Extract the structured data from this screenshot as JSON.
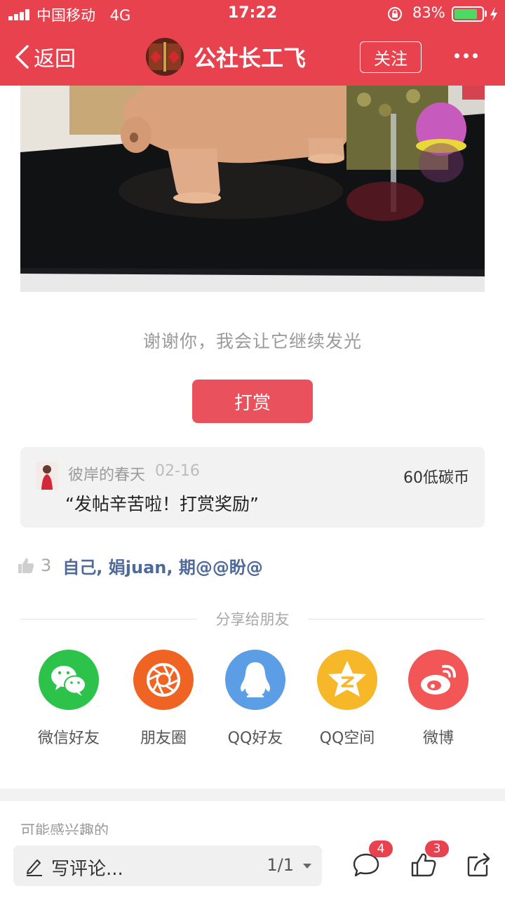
{
  "status_bar": {
    "carrier": "中国移动",
    "network": "4G",
    "time": "17:22",
    "battery_percent": "83%",
    "battery_level": 0.83
  },
  "nav": {
    "back_label": "返回",
    "title": "公社长工飞",
    "follow_label": "关注",
    "avatar_icon": "profile-avatar"
  },
  "post": {
    "thanks_text": "谢谢你，我会让它继续发光",
    "reward_button": "打赏"
  },
  "reward_record": {
    "user": "彼岸的春天",
    "date": "02-16",
    "amount": "60低碳币",
    "message": "“发帖辛苦啦！打赏奖励”"
  },
  "likes": {
    "count": "3",
    "names": "自己, 娟juan, 期@@盼@"
  },
  "share": {
    "label": "分享给朋友",
    "targets": [
      {
        "name": "微信好友",
        "icon": "wechat-icon",
        "color": "#2dc34b"
      },
      {
        "name": "朋友圈",
        "icon": "moments-icon",
        "color": "#f06423"
      },
      {
        "name": "QQ好友",
        "icon": "qq-icon",
        "color": "#5b9ee6"
      },
      {
        "name": "QQ空间",
        "icon": "qzone-icon",
        "color": "#f6b829"
      },
      {
        "name": "微博",
        "icon": "weibo-icon",
        "color": "#f25656"
      }
    ]
  },
  "section": {
    "interest_label": "可能感兴趣的"
  },
  "toolbar": {
    "comment_placeholder": "写评论...",
    "page_indicator": "1/1",
    "comment_badge": "4",
    "like_badge": "3"
  },
  "colors": {
    "brand_red": "#e8424f",
    "link_blue": "#4e6a9a"
  }
}
